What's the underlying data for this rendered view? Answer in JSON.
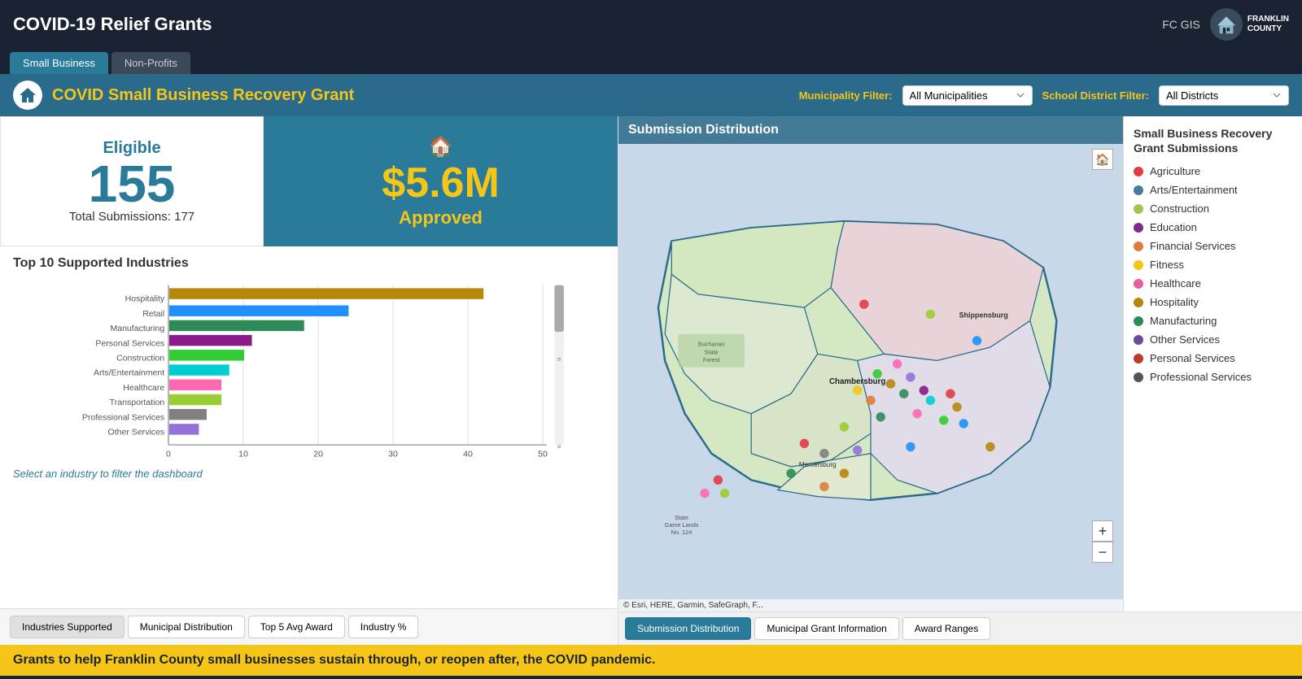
{
  "header": {
    "title": "COVID-19 Relief Grants",
    "fc_gis": "FC GIS",
    "logo_text": "FRANKLIN\nCOUNTY"
  },
  "tabs": [
    {
      "label": "Small Business",
      "active": true
    },
    {
      "label": "Non-Profits",
      "active": false
    }
  ],
  "banner": {
    "title": "COVID Small Business Recovery Grant",
    "municipality_filter_label": "Municipality Filter:",
    "municipality_filter_value": "All Municipalities",
    "school_district_filter_label": "School District Filter:",
    "school_district_filter_value": "All Districts"
  },
  "stats": {
    "eligible_label": "Eligible",
    "eligible_number": "155",
    "total_submissions": "Total Submissions: 177",
    "amount_value": "$5.6M",
    "amount_label": "Approved"
  },
  "chart": {
    "title": "Top 10 Supported Industries",
    "hint": "Select an industry to filter the dashboard",
    "bars": [
      {
        "label": "Hospitality",
        "value": 42,
        "color": "#b8860b"
      },
      {
        "label": "Retail",
        "value": 24,
        "color": "#1e90ff"
      },
      {
        "label": "Manufacturing",
        "value": 18,
        "color": "#2e8b57"
      },
      {
        "label": "Personal Services",
        "value": 11,
        "color": "#8b1a8b"
      },
      {
        "label": "Construction",
        "value": 10,
        "color": "#32cd32"
      },
      {
        "label": "Arts/Entertainment",
        "value": 8,
        "color": "#00ced1"
      },
      {
        "label": "Healthcare",
        "value": 7,
        "color": "#ff69b4"
      },
      {
        "label": "Transportation",
        "value": 7,
        "color": "#9acd32"
      },
      {
        "label": "Professional Services",
        "value": 5,
        "color": "#808080"
      },
      {
        "label": "Other Services",
        "value": 4,
        "color": "#9370db"
      }
    ],
    "max_value": 50,
    "axis_ticks": [
      0,
      10,
      20,
      30,
      40,
      50
    ]
  },
  "chart_tabs": [
    {
      "label": "Industries Supported",
      "active": true
    },
    {
      "label": "Municipal Distribution",
      "active": false
    },
    {
      "label": "Top 5 Avg Award",
      "active": false
    },
    {
      "label": "Industry %",
      "active": false
    }
  ],
  "map": {
    "title": "Submission Distribution",
    "attribution": "© Esri, HERE, Garmin, SafeGraph, F...",
    "zoom_in": "+",
    "zoom_out": "−"
  },
  "map_tabs": [
    {
      "label": "Submission Distribution",
      "active": true
    },
    {
      "label": "Municipal Grant Information",
      "active": false
    },
    {
      "label": "Award Ranges",
      "active": false
    }
  ],
  "legend": {
    "title": "Small Business Recovery Grant Submissions",
    "items": [
      {
        "label": "Agriculture",
        "color": "#e63946"
      },
      {
        "label": "Arts/Entertainment",
        "color": "#457b9d"
      },
      {
        "label": "Construction",
        "color": "#a8c256"
      },
      {
        "label": "Education",
        "color": "#7b2d8b"
      },
      {
        "label": "Financial Services",
        "color": "#e07c3a"
      },
      {
        "label": "Fitness",
        "color": "#f5c518"
      },
      {
        "label": "Healthcare",
        "color": "#e85d9c"
      },
      {
        "label": "Hospitality",
        "color": "#b8860b"
      },
      {
        "label": "Manufacturing",
        "color": "#2e8b57"
      },
      {
        "label": "Other Services",
        "color": "#6a4c93"
      },
      {
        "label": "Personal Services",
        "color": "#c0392b"
      },
      {
        "label": "Professional Services",
        "color": "#555555"
      }
    ]
  },
  "bottom_banner": {
    "text": "Grants to help Franklin County small businesses sustain through, or reopen after, the COVID pandemic."
  },
  "legend_extra": [
    {
      "label": "Recovery Grant",
      "color": "#e63946"
    }
  ]
}
